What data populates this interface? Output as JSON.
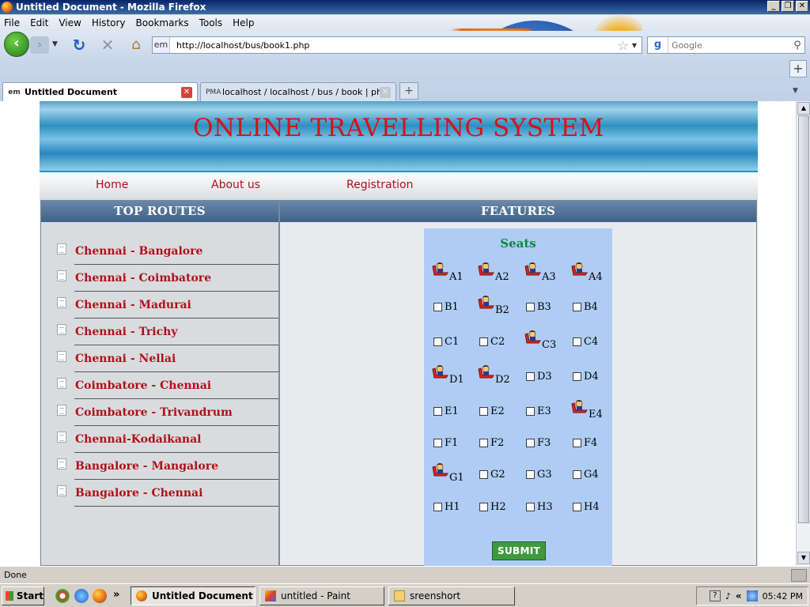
{
  "window": {
    "title": "Untitled Document - Mozilla Firefox",
    "minimize": "_",
    "restore": "❐",
    "close": "✕"
  },
  "menu": {
    "items": [
      "File",
      "Edit",
      "View",
      "History",
      "Bookmarks",
      "Tools",
      "Help"
    ]
  },
  "toolbar": {
    "site_identity": "em",
    "url": "http://localhost/bus/book1.php",
    "search_placeholder": "Google"
  },
  "tabs": [
    {
      "favicon_text": "em",
      "label": "Untitled Document",
      "active": true
    },
    {
      "favicon_text": "PMA",
      "label": "localhost / localhost / bus / book | php...",
      "active": false
    }
  ],
  "page": {
    "site_title": "ONLINE TRAVELLING SYSTEM",
    "nav": [
      "Home",
      "About us",
      "Registration"
    ],
    "left_heading": "TOP ROUTES",
    "right_heading": "FEATURES",
    "routes": [
      "Chennai - Bangalore",
      "Chennai - Coimbatore",
      "Chennai - Madurai",
      "Chennai - Trichy",
      "Chennai - Nellai",
      "Coimbatore - Chennai",
      "Coimbatore - Trivandrum",
      "Chennai-Kodaikanal",
      "Bangalore - Mangalore",
      "Bangalore - Chennai"
    ],
    "seats_title": "Seats",
    "seat_rows": [
      [
        {
          "id": "A1",
          "booked": true
        },
        {
          "id": "A2",
          "booked": true
        },
        {
          "id": "A3",
          "booked": true
        },
        {
          "id": "A4",
          "booked": true
        }
      ],
      [
        {
          "id": "B1",
          "booked": false
        },
        {
          "id": "B2",
          "booked": true
        },
        {
          "id": "B3",
          "booked": false
        },
        {
          "id": "B4",
          "booked": false
        }
      ],
      [
        {
          "id": "C1",
          "booked": false
        },
        {
          "id": "C2",
          "booked": false
        },
        {
          "id": "C3",
          "booked": true
        },
        {
          "id": "C4",
          "booked": false
        }
      ],
      [
        {
          "id": "D1",
          "booked": true
        },
        {
          "id": "D2",
          "booked": true
        },
        {
          "id": "D3",
          "booked": false
        },
        {
          "id": "D4",
          "booked": false
        }
      ],
      [
        {
          "id": "E1",
          "booked": false
        },
        {
          "id": "E2",
          "booked": false
        },
        {
          "id": "E3",
          "booked": false
        },
        {
          "id": "E4",
          "booked": true
        }
      ],
      [
        {
          "id": "F1",
          "booked": false
        },
        {
          "id": "F2",
          "booked": false
        },
        {
          "id": "F3",
          "booked": false
        },
        {
          "id": "F4",
          "booked": false
        }
      ],
      [
        {
          "id": "G1",
          "booked": true
        },
        {
          "id": "G2",
          "booked": false
        },
        {
          "id": "G3",
          "booked": false
        },
        {
          "id": "G4",
          "booked": false
        }
      ],
      [
        {
          "id": "H1",
          "booked": false
        },
        {
          "id": "H2",
          "booked": false
        },
        {
          "id": "H3",
          "booked": false
        },
        {
          "id": "H4",
          "booked": false
        }
      ]
    ],
    "submit_label": "SUBMIT"
  },
  "status": {
    "text": "Done"
  },
  "taskbar": {
    "start_label": "Start",
    "overflow": "»",
    "buttons": [
      {
        "label": "Untitled Document - ...",
        "icon": "firefox-icon",
        "pressed": true
      },
      {
        "label": "untitled - Paint",
        "icon": "paint-icon",
        "pressed": false
      },
      {
        "label": "sreenshort",
        "icon": "folder-icon",
        "pressed": false
      }
    ],
    "tray_help": "?",
    "tray_collapse": "«",
    "clock": "05:42 PM"
  },
  "colors": {
    "title_red": "#d41414",
    "link_red": "#b0101a",
    "seats_green": "#0a8a3a",
    "seat_panel_bg": "#afcdf4",
    "submit_green": "#3f9a3f",
    "column_header": "#3f6286"
  }
}
